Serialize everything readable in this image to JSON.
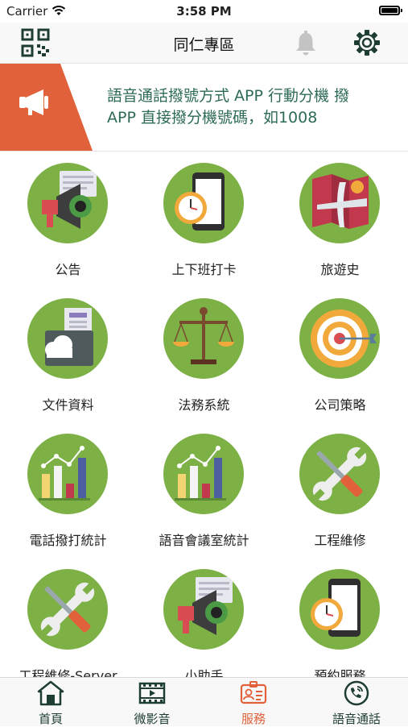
{
  "status_bar": {
    "carrier": "Carrier",
    "time": "3:58 PM"
  },
  "header": {
    "title": "同仁專區"
  },
  "banner": {
    "text_line1": "語音通話撥號方式 APP 行動分機 撥",
    "text_line2": "APP 直接撥分機號碼，如1008"
  },
  "grid": {
    "items": [
      {
        "label": "公告",
        "icon": "megaphone-icon"
      },
      {
        "label": "上下班打卡",
        "icon": "clock-phone-icon"
      },
      {
        "label": "旅遊史",
        "icon": "airplane-map-icon"
      },
      {
        "label": "文件資料",
        "icon": "folder-cloud-icon"
      },
      {
        "label": "法務系統",
        "icon": "scales-icon"
      },
      {
        "label": "公司策略",
        "icon": "target-icon"
      },
      {
        "label": "電話撥打統計",
        "icon": "bar-chart-icon"
      },
      {
        "label": "語音會議室統計",
        "icon": "bar-chart-icon"
      },
      {
        "label": "工程維修",
        "icon": "wrench-screwdriver-icon"
      },
      {
        "label": "工程維修-Server",
        "icon": "wrench-screwdriver-icon"
      },
      {
        "label": "小助手",
        "icon": "megaphone-icon"
      },
      {
        "label": "預約服務",
        "icon": "clock-phone-icon"
      }
    ]
  },
  "tab_bar": {
    "tabs": [
      {
        "label": "首頁",
        "icon": "home-icon"
      },
      {
        "label": "微影音",
        "icon": "film-icon"
      },
      {
        "label": "服務",
        "icon": "id-card-icon",
        "active": true
      },
      {
        "label": "語音通話",
        "icon": "phone-call-icon"
      }
    ]
  },
  "colors": {
    "accent": "#e0613a",
    "icon_circle": "#7db146",
    "banner_text": "#2e6b57",
    "tab_text": "#1e3d33"
  }
}
